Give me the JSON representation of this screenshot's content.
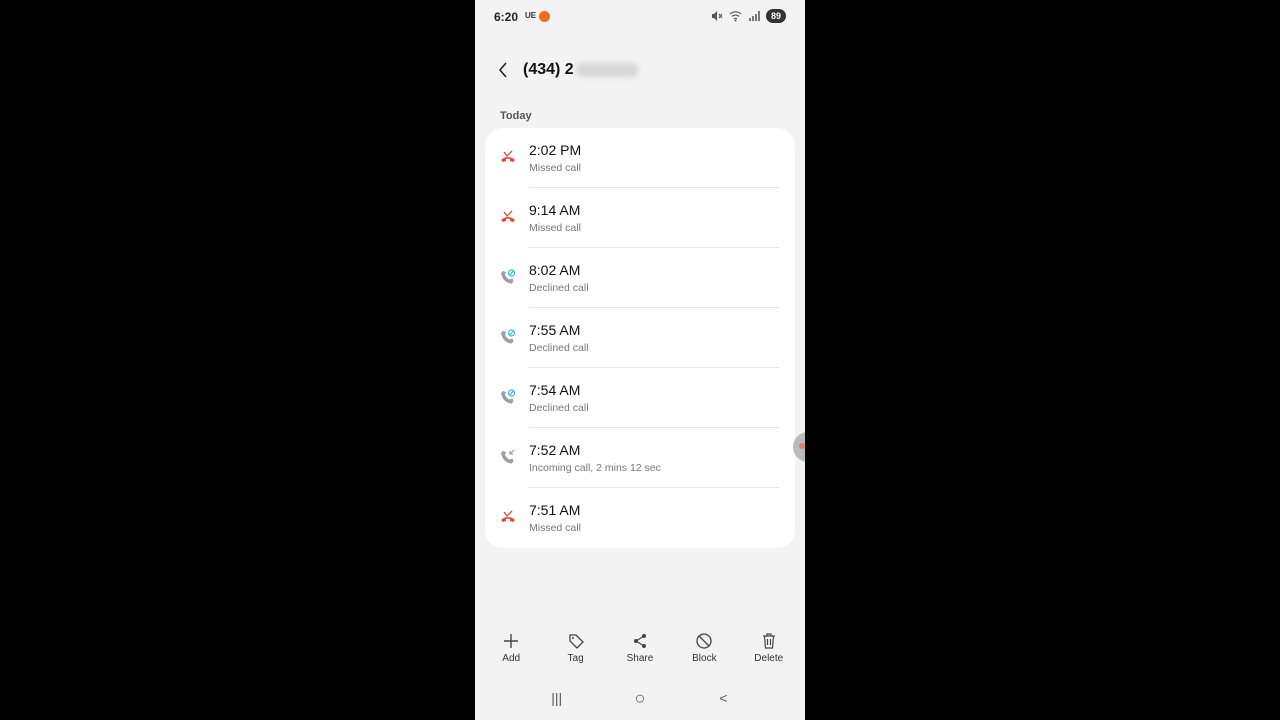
{
  "status_bar": {
    "time": "6:20",
    "carrier": "UE",
    "mute_icon": "🔇",
    "wifi_icon": "wifi",
    "signal_icon": "signal",
    "battery": "89"
  },
  "header": {
    "title": "(434) 2",
    "back_icon": "chevron-left-icon"
  },
  "section_label": "Today",
  "colors": {
    "missed": "#e0463b",
    "declined": "#3fb6c9",
    "incoming": "#9aa0a6"
  },
  "calls": [
    {
      "time": "2:02 PM",
      "status": "Missed call",
      "type": "missed"
    },
    {
      "time": "9:14 AM",
      "status": "Missed call",
      "type": "missed"
    },
    {
      "time": "8:02 AM",
      "status": "Declined call",
      "type": "declined"
    },
    {
      "time": "7:55 AM",
      "status": "Declined call",
      "type": "declined"
    },
    {
      "time": "7:54 AM",
      "status": "Declined call",
      "type": "declined"
    },
    {
      "time": "7:52 AM",
      "status": "Incoming call, 2 mins 12 sec",
      "type": "incoming"
    },
    {
      "time": "7:51 AM",
      "status": "Missed call",
      "type": "missed"
    }
  ],
  "actions": [
    {
      "label": "Add",
      "icon": "plus-icon"
    },
    {
      "label": "Tag",
      "icon": "tag-icon"
    },
    {
      "label": "Share",
      "icon": "share-icon"
    },
    {
      "label": "Block",
      "icon": "block-icon"
    },
    {
      "label": "Delete",
      "icon": "trash-icon"
    }
  ],
  "navbar": {
    "recents": "|||",
    "home": "○",
    "back": "<"
  }
}
